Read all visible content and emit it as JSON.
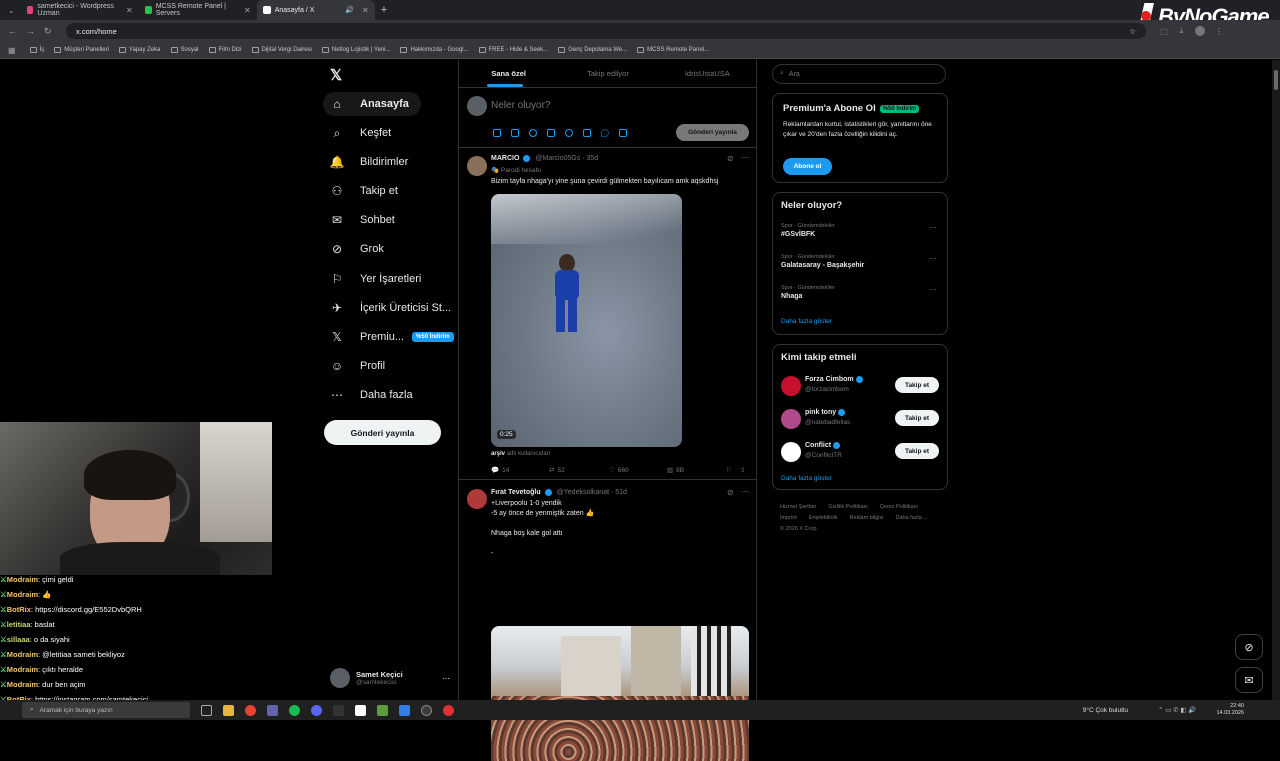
{
  "browser": {
    "tabs": [
      {
        "title": "sametkecici - Wordpress Uzman",
        "favicon_color": "#e8417a",
        "active": false
      },
      {
        "title": "MCSS Remote Panel | Servers",
        "favicon_color": "#27c24c",
        "active": false
      },
      {
        "title": "Anasayfa / X",
        "favicon_color": "#ffffff",
        "active": true
      }
    ],
    "url": "x.com/home",
    "bookmarks": [
      "İş",
      "Müşteri Panelleri",
      "Yapay Zeka",
      "Sosyal",
      "Film Dizi",
      "Dijital Vergi Dairesi",
      "Netlog Lojistik | Yeni...",
      "Hakkımızda - Googl...",
      "FREE - Hide & Seek...",
      "Genç Depolama We...",
      "MCSS Remote Panel..."
    ]
  },
  "logo": {
    "text": "ByNoGame"
  },
  "nav": {
    "items": [
      {
        "label": "Anasayfa",
        "icon": "home-icon",
        "glyph": "⌂"
      },
      {
        "label": "Keşfet",
        "icon": "search-icon",
        "glyph": "⌕"
      },
      {
        "label": "Bildirimler",
        "icon": "bell-icon",
        "glyph": "🔔"
      },
      {
        "label": "Takip et",
        "icon": "follow-icon",
        "glyph": "⚇"
      },
      {
        "label": "Sohbet",
        "icon": "mail-icon",
        "glyph": "✉"
      },
      {
        "label": "Grok",
        "icon": "grok-icon",
        "glyph": "⊘"
      },
      {
        "label": "Yer İşaretleri",
        "icon": "bookmark-icon",
        "glyph": "⚐"
      },
      {
        "label": "İçerik Üreticisi St...",
        "icon": "rocket-icon",
        "glyph": "✈"
      },
      {
        "label": "Premiu...",
        "icon": "x-logo-icon",
        "glyph": "𝕏"
      },
      {
        "label": "Profil",
        "icon": "profile-icon",
        "glyph": "☺"
      },
      {
        "label": "Daha fazla",
        "icon": "more-icon",
        "glyph": "⋯"
      }
    ],
    "premium_badge": "%50 İndirim",
    "post_button": "Gönderi yayınla",
    "profile_name": "Samet Keçici",
    "profile_handle": "@samtekecici"
  },
  "center": {
    "tabs": [
      "Sana özel",
      "Takip edilyor",
      "IdrisUstaUSA"
    ],
    "composer_placeholder": "Neler oluyor?",
    "composer_button": "Gönderi yayınla",
    "tweets": [
      {
        "name": "MARCIO",
        "handle": "@Marcio05Gs · 35d",
        "sub": "Parodi hesabı",
        "text": "Bizim tayfa nhaga'yı yine şuna çevirdi gülmekten bayılıcam amk aqskdhsj",
        "video_time": "0:25",
        "source_user": "arşiv",
        "source_rest": "adlı kullanıcıdan",
        "replies": "14",
        "retweets": "52",
        "likes": "660",
        "views": "8B"
      },
      {
        "name": "Fırat Tevetoğlu",
        "handle": "@Yedeksolkanat · 51d",
        "line1": "+Liverpoolu 1-0 yendik",
        "line2": "-5 ay önce de yenmiştik zaten 👍",
        "line3": "Nhaga boş kale gol attı",
        "line4": "-"
      }
    ]
  },
  "right": {
    "search_placeholder": "Ara",
    "premium": {
      "title": "Premium'a Abone Ol",
      "badge": "%50 İndirim",
      "text": "Reklamlardan kurtul, istatistikleri gör, yanıtlarını öne çıkar ve 20'den fazla özelliğin kilidini aç.",
      "button": "Abone ol"
    },
    "trends": {
      "title": "Neler oluyor?",
      "items": [
        {
          "meta": "Spor · Gündemdekiler",
          "tag": "#GSvİBFK"
        },
        {
          "meta": "Spor · Gündemdekiler",
          "tag": "Galatasaray - Başakşehir"
        },
        {
          "meta": "Spor · Gündemdekiler",
          "tag": "Nhaga"
        }
      ],
      "more": "Daha fazla göster"
    },
    "who_to_follow": {
      "title": "Kimi takip etmeli",
      "items": [
        {
          "name": "Forza Cimbom",
          "handle": "@forzacimbom",
          "button": "Takip et",
          "avatar_color": "#c8102e"
        },
        {
          "name": "pink tony",
          "handle": "@natebadfellas",
          "button": "Takip et",
          "avatar_color": "#b04a8a"
        },
        {
          "name": "Conflict",
          "handle": "@ConflictTR",
          "button": "Takip et",
          "avatar_color": "#ffffff"
        }
      ],
      "more": "Daha fazla göster"
    },
    "footer": {
      "line1": [
        "Hizmet Şartları",
        "Gizlilik Politikası",
        "Çerez Politikası"
      ],
      "line2": [
        "Imprint",
        "Erişilebilirlik",
        "Reklam bilgisi",
        "Daha fazla ..."
      ],
      "copyright": "© 2026 X Corp."
    }
  },
  "chat": [
    {
      "user": "Modraim",
      "msg": "çimi geldi",
      "user_color": "#f4c36a"
    },
    {
      "user": "Modraim",
      "msg": "👍",
      "user_color": "#f4c36a"
    },
    {
      "user": "BotRix",
      "msg": "https://discord.gg/E552DvbQRH",
      "user_color": "#f4c36a"
    },
    {
      "user": "letitiaa",
      "msg": "baslat",
      "user_color": "#c4d86a"
    },
    {
      "user": "sillaaa",
      "msg": "o da siyahi",
      "user_color": "#c4d86a"
    },
    {
      "user": "Modraim",
      "msg": "@letitiaa sameti bekliyoz",
      "user_color": "#f4c36a"
    },
    {
      "user": "Modraim",
      "msg": "çıktı heralde",
      "user_color": "#f4c36a"
    },
    {
      "user": "Modraim",
      "msg": "dur ben açim",
      "user_color": "#f4c36a"
    },
    {
      "user": "BotRix",
      "msg": "https://instagram.com/samtekecici",
      "user_color": "#f4c36a"
    }
  ],
  "taskbar": {
    "search_placeholder": "Aramak için buraya yazın",
    "weather": "9°C  Çok bulutlu",
    "time": "22:40",
    "date": "14.03.2026"
  }
}
